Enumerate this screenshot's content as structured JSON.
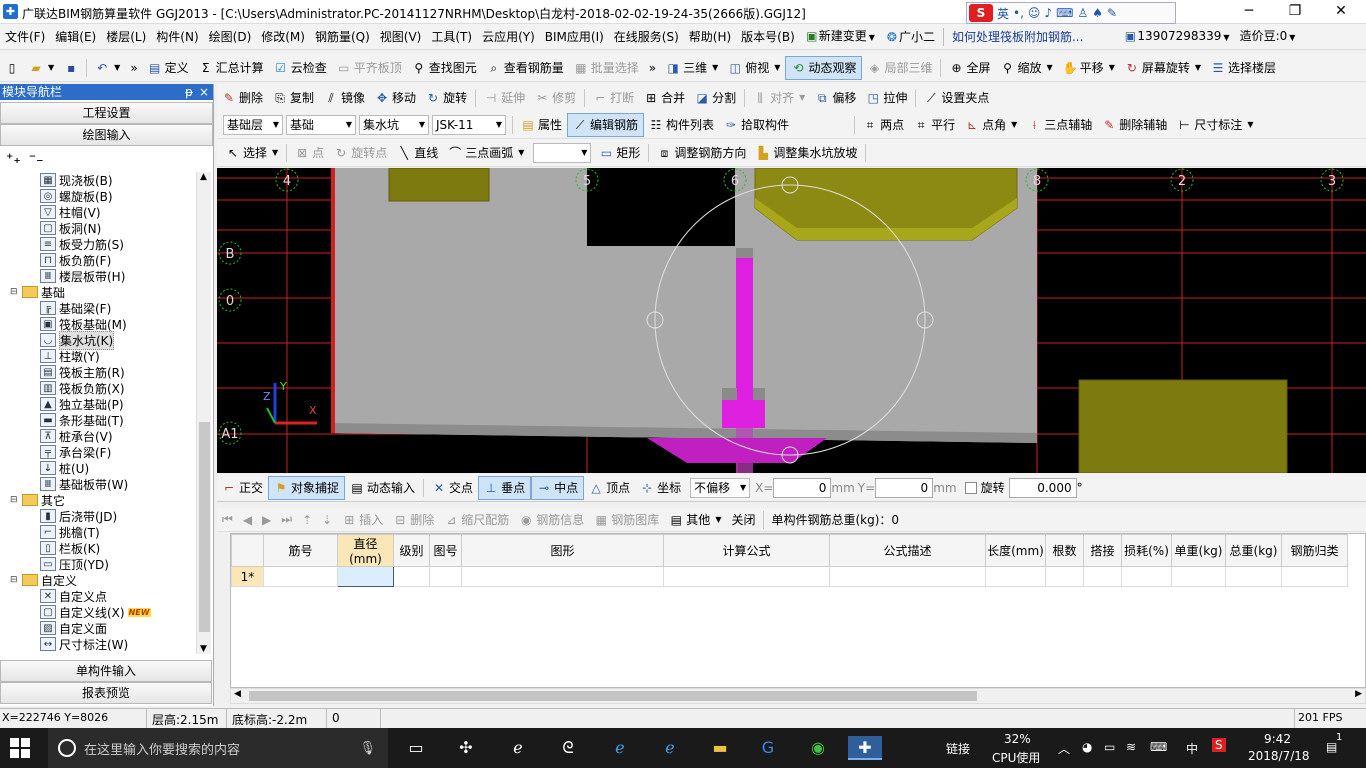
{
  "titlebar": {
    "title": "广联达BIM钢筋算量软件 GGJ2013 - [C:\\Users\\Administrator.PC-20141127NRHM\\Desktop\\白龙村-2018-02-02-19-24-35(2666版).GGJ12]",
    "ime_label": "英",
    "win_min": "─",
    "win_max": "❐",
    "win_close": "✕"
  },
  "menubar": {
    "items": [
      "文件(F)",
      "编辑(E)",
      "楼层(L)",
      "构件(N)",
      "绘图(D)",
      "修改(M)",
      "钢筋量(Q)",
      "视图(V)",
      "工具(T)",
      "云应用(Y)",
      "BIM应用(I)",
      "在线服务(S)",
      "帮助(H)",
      "版本号(B)",
      "新建变更",
      "广小二"
    ],
    "help_link": "如何处理筏板附加钢筋...",
    "phone": "13907298339",
    "beans": "造价豆:0"
  },
  "toolbar1": {
    "items": [
      "定义",
      "汇总计算",
      "云检查",
      "平齐板顶",
      "查找图元",
      "查看钢筋量",
      "批量选择",
      "三维",
      "俯视",
      "动态观察",
      "局部三维",
      "全屏",
      "缩放",
      "平移",
      "屏幕旋转",
      "选择楼层"
    ]
  },
  "toolbar2": {
    "items": [
      "删除",
      "复制",
      "镜像",
      "移动",
      "旋转",
      "延伸",
      "修剪",
      "打断",
      "合并",
      "分割",
      "对齐",
      "偏移",
      "拉伸",
      "设置夹点"
    ]
  },
  "toolbar3": {
    "layer": "基础层",
    "category": "基础",
    "type": "集水坑",
    "name": "JSK-11",
    "items": [
      "属性",
      "编辑钢筋",
      "构件列表",
      "拾取构件",
      "两点",
      "平行",
      "点角",
      "三点辅轴",
      "删除辅轴",
      "尺寸标注"
    ]
  },
  "toolbar4": {
    "items": [
      "选择",
      "点",
      "旋转点",
      "直线",
      "三点画弧",
      "矩形",
      "调整钢筋方向",
      "调整集水坑放坡"
    ]
  },
  "leftpane": {
    "title": "模块导航栏",
    "pin": "ᵽ",
    "close": "×",
    "top_buttons": [
      "工程设置",
      "绘图输入"
    ],
    "bottom_buttons": [
      "单构件输入",
      "报表预览"
    ],
    "tree": [
      {
        "label": "现浇板(B)",
        "icon": "▦",
        "level": 2
      },
      {
        "label": "螺旋板(B)",
        "icon": "◎",
        "level": 2
      },
      {
        "label": "柱帽(V)",
        "icon": "▽",
        "level": 2
      },
      {
        "label": "板洞(N)",
        "icon": "▢",
        "level": 2
      },
      {
        "label": "板受力筋(S)",
        "icon": "≡",
        "level": 2
      },
      {
        "label": "板负筋(F)",
        "icon": "⊓",
        "level": 2
      },
      {
        "label": "楼层板带(H)",
        "icon": "Ⅲ",
        "level": 2
      },
      {
        "label": "基础",
        "icon": "folder",
        "level": 1,
        "expanded": "⊟"
      },
      {
        "label": "基础梁(F)",
        "icon": "╔",
        "level": 2
      },
      {
        "label": "筏板基础(M)",
        "icon": "▣",
        "level": 2
      },
      {
        "label": "集水坑(K)",
        "icon": "◡",
        "level": 2,
        "selected": true
      },
      {
        "label": "柱墩(Y)",
        "icon": "⊥",
        "level": 2
      },
      {
        "label": "筏板主筋(R)",
        "icon": "▤",
        "level": 2
      },
      {
        "label": "筏板负筋(X)",
        "icon": "▥",
        "level": 2
      },
      {
        "label": "独立基础(P)",
        "icon": "▲",
        "level": 2
      },
      {
        "label": "条形基础(T)",
        "icon": "▬",
        "level": 2
      },
      {
        "label": "桩承台(V)",
        "icon": "⊼",
        "level": 2
      },
      {
        "label": "承台梁(F)",
        "icon": "╤",
        "level": 2
      },
      {
        "label": "桩(U)",
        "icon": "↓",
        "level": 2
      },
      {
        "label": "基础板带(W)",
        "icon": "Ⅲ",
        "level": 2
      },
      {
        "label": "其它",
        "icon": "folder",
        "level": 1,
        "expanded": "⊟"
      },
      {
        "label": "后浇带(JD)",
        "icon": "▮",
        "level": 2
      },
      {
        "label": "挑檐(T)",
        "icon": "⌐",
        "level": 2
      },
      {
        "label": "栏板(K)",
        "icon": "▯",
        "level": 2
      },
      {
        "label": "压顶(YD)",
        "icon": "▭",
        "level": 2
      },
      {
        "label": "自定义",
        "icon": "folder",
        "level": 1,
        "expanded": "⊟"
      },
      {
        "label": "自定义点",
        "icon": "✕",
        "level": 2
      },
      {
        "label": "自定义线(X)",
        "icon": "▢",
        "level": 2,
        "badge": "NEW"
      },
      {
        "label": "自定义面",
        "icon": "▨",
        "level": 2
      },
      {
        "label": "尺寸标注(W)",
        "icon": "↔",
        "level": 2
      }
    ]
  },
  "canvas": {
    "axis_labels": [
      "4",
      "5",
      "6",
      "8",
      "2",
      "3",
      "B",
      "0",
      "A1"
    ],
    "coord_axes": [
      "Z",
      "Y",
      "X"
    ]
  },
  "statustb": {
    "items": [
      "正交",
      "对象捕捉",
      "动态输入",
      "交点",
      "垂点",
      "中点",
      "顶点",
      "坐标"
    ],
    "offset": "不偏移",
    "x_label": "X=",
    "x_val": "0",
    "y_label": "Y=",
    "y_val": "0",
    "unit": "mm",
    "rotate_label": "旋转",
    "rotate_val": "0.000",
    "deg": "°"
  },
  "rebartb": {
    "items": [
      "插入",
      "删除",
      "缩尺配筋",
      "钢筋信息",
      "钢筋图库",
      "其他",
      "关闭"
    ],
    "total": "单构件钢筋总重(kg)：0"
  },
  "grid": {
    "columns": [
      "筋号",
      "直径(mm)",
      "级别",
      "图号",
      "图形",
      "计算公式",
      "公式描述",
      "长度(mm)",
      "根数",
      "搭接",
      "损耗(%)",
      "单重(kg)",
      "总重(kg)",
      "钢筋归类"
    ],
    "rows": [
      {
        "num": "1*"
      }
    ]
  },
  "statusbar": {
    "coords": "X=222746 Y=8026",
    "floor_h": "层高:2.15m",
    "bottom_h": "底标高:-2.2m",
    "zero": "0",
    "fps": "201 FPS"
  },
  "taskbar": {
    "search_placeholder": "在这里输入你要搜索的内容",
    "link_label": "链接",
    "cpu_pct": "32%",
    "cpu_label": "CPU使用",
    "lang": "中",
    "time": "9:42",
    "date": "2018/7/18",
    "notif": "1"
  }
}
